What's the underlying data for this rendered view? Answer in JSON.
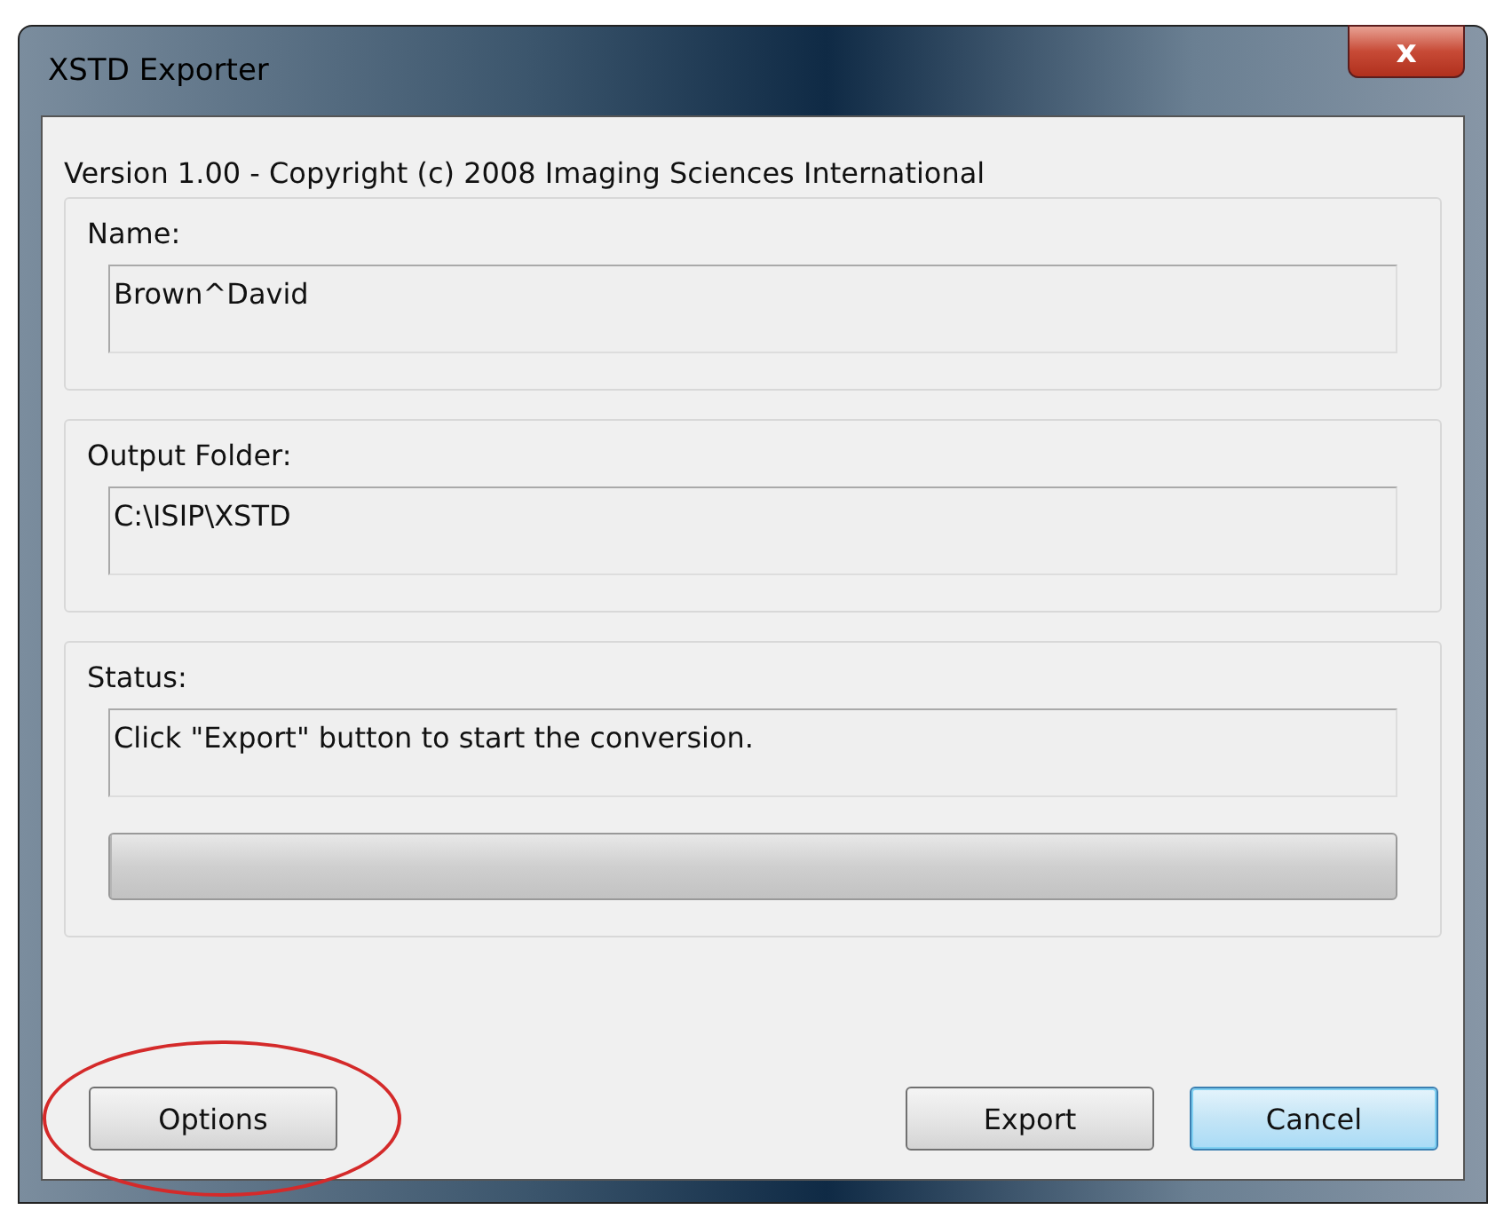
{
  "window": {
    "title": "XSTD Exporter",
    "close_label": "x"
  },
  "version_text": "Version 1.00 - Copyright (c) 2008 Imaging Sciences International",
  "groups": [
    {
      "label": "Name:",
      "kind": "field",
      "value": "Brown^David"
    },
    {
      "label": "Output Folder:",
      "kind": "field",
      "value": "C:\\ISIP\\XSTD"
    },
    {
      "label": "Status:",
      "kind": "status",
      "value": "Click \"Export\" button to start the conversion.",
      "level": 0
    }
  ],
  "left_buttons": [
    {
      "label": "Options",
      "focused": false,
      "highlighted": true
    }
  ],
  "right_buttons": [
    {
      "label": "Export",
      "focused": false,
      "highlighted": false
    },
    {
      "label": "Cancel",
      "focused": true,
      "highlighted": false
    }
  ]
}
